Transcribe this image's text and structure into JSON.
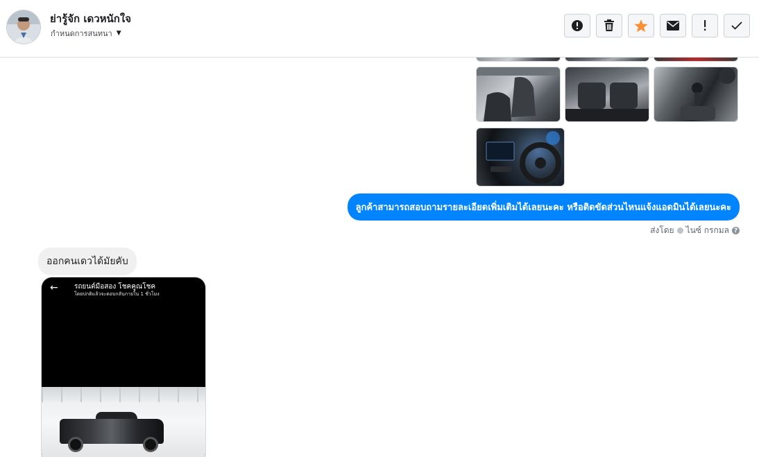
{
  "header": {
    "contact_name": "ย่ารู้จัก เดวหนักใจ",
    "assign_label": "กำหนดการสนทนา",
    "toolbar": [
      {
        "name": "spam-button",
        "icon": "alert-circle-icon"
      },
      {
        "name": "delete-button",
        "icon": "trash-icon"
      },
      {
        "name": "star-button",
        "icon": "star-icon",
        "color": "#f7923b"
      },
      {
        "name": "mark-unread-button",
        "icon": "envelope-icon"
      },
      {
        "name": "follow-up-button",
        "icon": "exclamation-icon"
      },
      {
        "name": "mark-done-button",
        "icon": "check-icon"
      }
    ]
  },
  "thread": {
    "outgoing_message": "ลูกค้าสามารถสอบถามรายละเอียดเพิ่มเติมได้เลยนะคะ หรือติดขัดส่วนไหนแจ้งแอดมินได้เลยนะคะ",
    "sent_by_prefix": "ส่งโดย",
    "sent_by_name": "ไนซ์ กรกมล",
    "incoming_message": "ออกคนเดวได้มัยคับ",
    "screenshot": {
      "title": "รถยนต์มือสอง โชคคูณโชค",
      "subtitle": "โดยปกติแล้วจะตอบกลับภายใน 1 ชั่วโมง"
    }
  },
  "colors": {
    "outgoing_bubble": "#0084ff",
    "incoming_bubble": "#f1f0f0",
    "star_accent": "#f7923b"
  }
}
